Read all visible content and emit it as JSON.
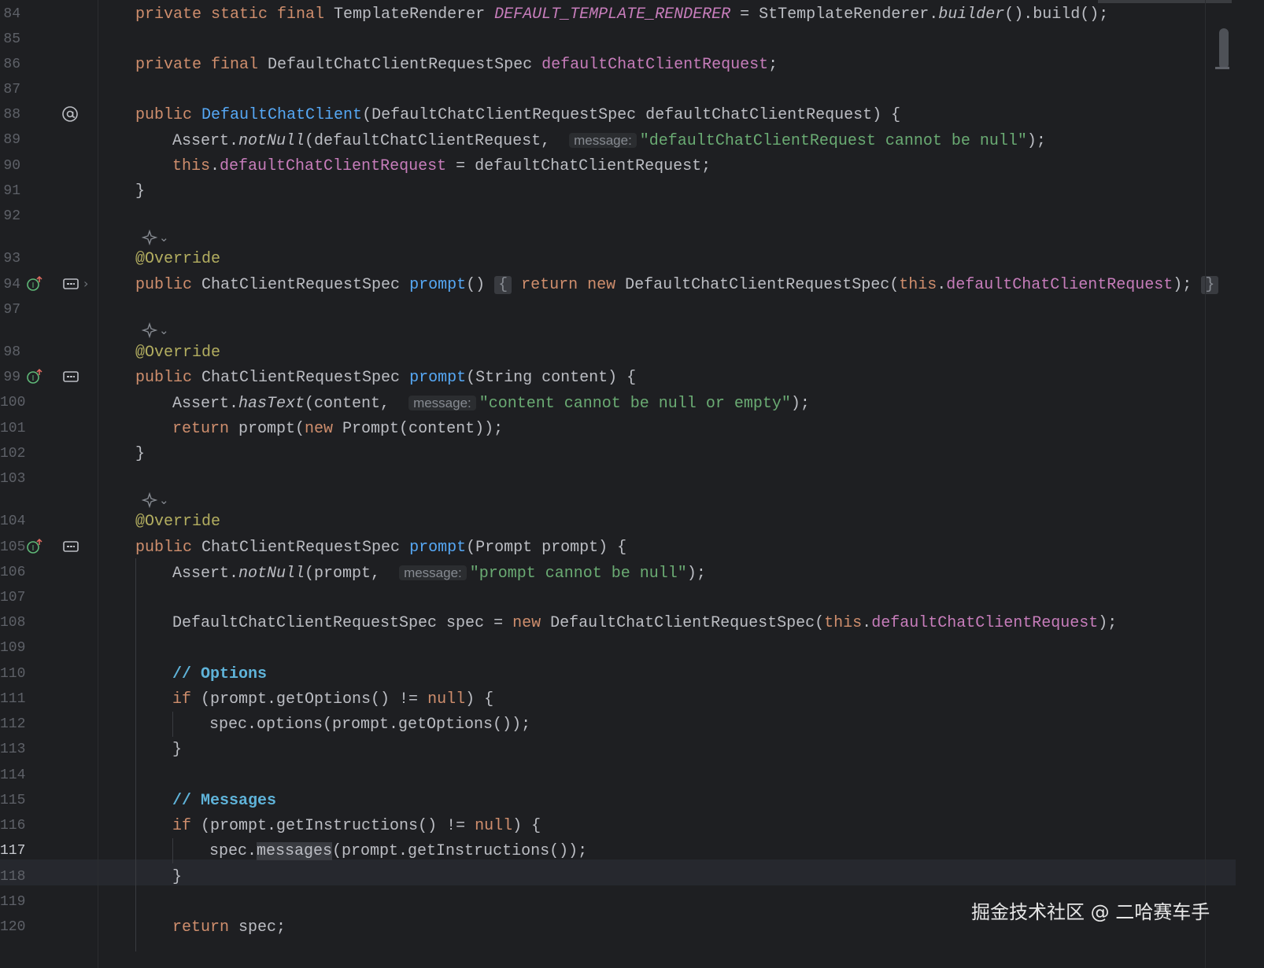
{
  "lines": [
    {
      "num": "84",
      "indent": 0,
      "tokens": [
        [
          "kw",
          "private static final "
        ],
        [
          "plain",
          "TemplateRenderer "
        ],
        [
          "fieldi",
          "DEFAULT_TEMPLATE_RENDERER"
        ],
        [
          "plain",
          " = StTemplateRenderer."
        ],
        [
          "italic",
          "builder"
        ],
        [
          "plain",
          "().build();"
        ]
      ]
    },
    {
      "num": "85",
      "indent": 0,
      "tokens": []
    },
    {
      "num": "86",
      "indent": 0,
      "tokens": [
        [
          "kw",
          "private final "
        ],
        [
          "plain",
          "DefaultChatClientRequestSpec "
        ],
        [
          "field",
          "defaultChatClientRequest"
        ],
        [
          "plain",
          ";"
        ]
      ]
    },
    {
      "num": "87",
      "indent": 0,
      "tokens": []
    },
    {
      "num": "88",
      "indent": 0,
      "tokens": [
        [
          "kw",
          "public "
        ],
        [
          "method",
          "DefaultChatClient"
        ],
        [
          "plain",
          "(DefaultChatClientRequestSpec defaultChatClientRequest) {"
        ]
      ]
    },
    {
      "num": "89",
      "indent": 1,
      "tokens": [
        [
          "plain",
          "Assert."
        ],
        [
          "italic",
          "notNull"
        ],
        [
          "plain",
          "(defaultChatClientRequest,  "
        ],
        [
          "hint",
          "message:"
        ],
        [
          "str",
          "\"defaultChatClientRequest cannot be null\""
        ],
        [
          "plain",
          ");"
        ]
      ]
    },
    {
      "num": "90",
      "indent": 1,
      "tokens": [
        [
          "kw",
          "this"
        ],
        [
          "plain",
          "."
        ],
        [
          "field",
          "defaultChatClientRequest"
        ],
        [
          "plain",
          " = defaultChatClientRequest;"
        ]
      ]
    },
    {
      "num": "91",
      "indent": 0,
      "tokens": [
        [
          "plain",
          "}"
        ]
      ]
    },
    {
      "num": "92",
      "indent": 0,
      "tokens": []
    },
    {
      "num": "93",
      "indent": 0,
      "tokens": [
        [
          "ann",
          "@Override"
        ]
      ]
    },
    {
      "num": "94",
      "indent": 0,
      "tokens": [
        [
          "kw",
          "public "
        ],
        [
          "plain",
          "ChatClientRequestSpec "
        ],
        [
          "method",
          "prompt"
        ],
        [
          "plain",
          "() "
        ],
        [
          "fold",
          "{"
        ],
        [
          "plain",
          " "
        ],
        [
          "kw",
          "return new "
        ],
        [
          "plain",
          "DefaultChatClientRequestSpec("
        ],
        [
          "kw",
          "this"
        ],
        [
          "plain",
          "."
        ],
        [
          "field",
          "defaultChatClientRequest"
        ],
        [
          "plain",
          "); "
        ],
        [
          "fold",
          "}"
        ]
      ]
    },
    {
      "num": "97",
      "indent": 0,
      "tokens": []
    },
    {
      "num": "98",
      "indent": 0,
      "tokens": [
        [
          "ann",
          "@Override"
        ]
      ]
    },
    {
      "num": "99",
      "indent": 0,
      "tokens": [
        [
          "kw",
          "public "
        ],
        [
          "plain",
          "ChatClientRequestSpec "
        ],
        [
          "method",
          "prompt"
        ],
        [
          "plain",
          "(String content) {"
        ]
      ]
    },
    {
      "num": "100",
      "indent": 1,
      "tokens": [
        [
          "plain",
          "Assert."
        ],
        [
          "italic",
          "hasText"
        ],
        [
          "plain",
          "(content,  "
        ],
        [
          "hint",
          "message:"
        ],
        [
          "str",
          "\"content cannot be null or empty\""
        ],
        [
          "plain",
          ");"
        ]
      ]
    },
    {
      "num": "101",
      "indent": 1,
      "tokens": [
        [
          "kw",
          "return "
        ],
        [
          "plain",
          "prompt("
        ],
        [
          "kw",
          "new "
        ],
        [
          "plain",
          "Prompt(content));"
        ]
      ]
    },
    {
      "num": "102",
      "indent": 0,
      "tokens": [
        [
          "plain",
          "}"
        ]
      ]
    },
    {
      "num": "103",
      "indent": 0,
      "tokens": []
    },
    {
      "num": "104",
      "indent": 0,
      "tokens": [
        [
          "ann",
          "@Override"
        ]
      ]
    },
    {
      "num": "105",
      "indent": 0,
      "tokens": [
        [
          "kw",
          "public "
        ],
        [
          "plain",
          "ChatClientRequestSpec "
        ],
        [
          "method",
          "prompt"
        ],
        [
          "plain",
          "(Prompt prompt) {"
        ]
      ]
    },
    {
      "num": "106",
      "indent": 1,
      "tokens": [
        [
          "plain",
          "Assert."
        ],
        [
          "italic",
          "notNull"
        ],
        [
          "plain",
          "(prompt,  "
        ],
        [
          "hint",
          "message:"
        ],
        [
          "str",
          "\"prompt cannot be null\""
        ],
        [
          "plain",
          ");"
        ]
      ]
    },
    {
      "num": "107",
      "indent": 0,
      "tokens": []
    },
    {
      "num": "108",
      "indent": 1,
      "tokens": [
        [
          "plain",
          "DefaultChatClientRequestSpec spec = "
        ],
        [
          "kw",
          "new "
        ],
        [
          "plain",
          "DefaultChatClientRequestSpec("
        ],
        [
          "kw",
          "this"
        ],
        [
          "plain",
          "."
        ],
        [
          "field",
          "defaultChatClientRequest"
        ],
        [
          "plain",
          ");"
        ]
      ]
    },
    {
      "num": "109",
      "indent": 0,
      "tokens": []
    },
    {
      "num": "110",
      "indent": 1,
      "tokens": [
        [
          "comment",
          "// Options"
        ]
      ]
    },
    {
      "num": "111",
      "indent": 1,
      "tokens": [
        [
          "kw",
          "if "
        ],
        [
          "plain",
          "(prompt.getOptions() != "
        ],
        [
          "kw",
          "null"
        ],
        [
          "plain",
          ") {"
        ]
      ]
    },
    {
      "num": "112",
      "indent": 2,
      "tokens": [
        [
          "plain",
          "spec.options(prompt.getOptions());"
        ]
      ]
    },
    {
      "num": "113",
      "indent": 1,
      "tokens": [
        [
          "plain",
          "}"
        ]
      ]
    },
    {
      "num": "114",
      "indent": 0,
      "tokens": []
    },
    {
      "num": "115",
      "indent": 1,
      "tokens": [
        [
          "comment",
          "// Messages"
        ]
      ]
    },
    {
      "num": "116",
      "indent": 1,
      "tokens": [
        [
          "kw",
          "if "
        ],
        [
          "plain",
          "(prompt.getInstructions() != "
        ],
        [
          "kw",
          "null"
        ],
        [
          "plain",
          ") {"
        ]
      ]
    },
    {
      "num": "117",
      "indent": 2,
      "tokens": [
        [
          "plain",
          "spec."
        ],
        [
          "usage",
          "messages"
        ],
        [
          "plain",
          "(prompt.getInstructions());"
        ]
      ]
    },
    {
      "num": "118",
      "indent": 1,
      "tokens": [
        [
          "plain",
          "}"
        ]
      ]
    },
    {
      "num": "119",
      "indent": 0,
      "tokens": []
    },
    {
      "num": "120",
      "indent": 1,
      "tokens": [
        [
          "kw",
          "return "
        ],
        [
          "plain",
          "spec;"
        ]
      ]
    }
  ],
  "current_line": "117",
  "gutter_icons": {
    "at_sign": "@",
    "implements_up": "I↑",
    "ai_sparkle": "✦⌄",
    "collapse_chevron": "›"
  },
  "colors": {
    "background": "#1e1f22",
    "keyword": "#cf8e6d",
    "field": "#c77dbb",
    "method": "#56a8f5",
    "string": "#6aab73",
    "annotation": "#b3ae60",
    "comment": "#5fb3d9",
    "text": "#bcbec4"
  },
  "watermark": "掘金技术社区 @ 二哈赛车手"
}
